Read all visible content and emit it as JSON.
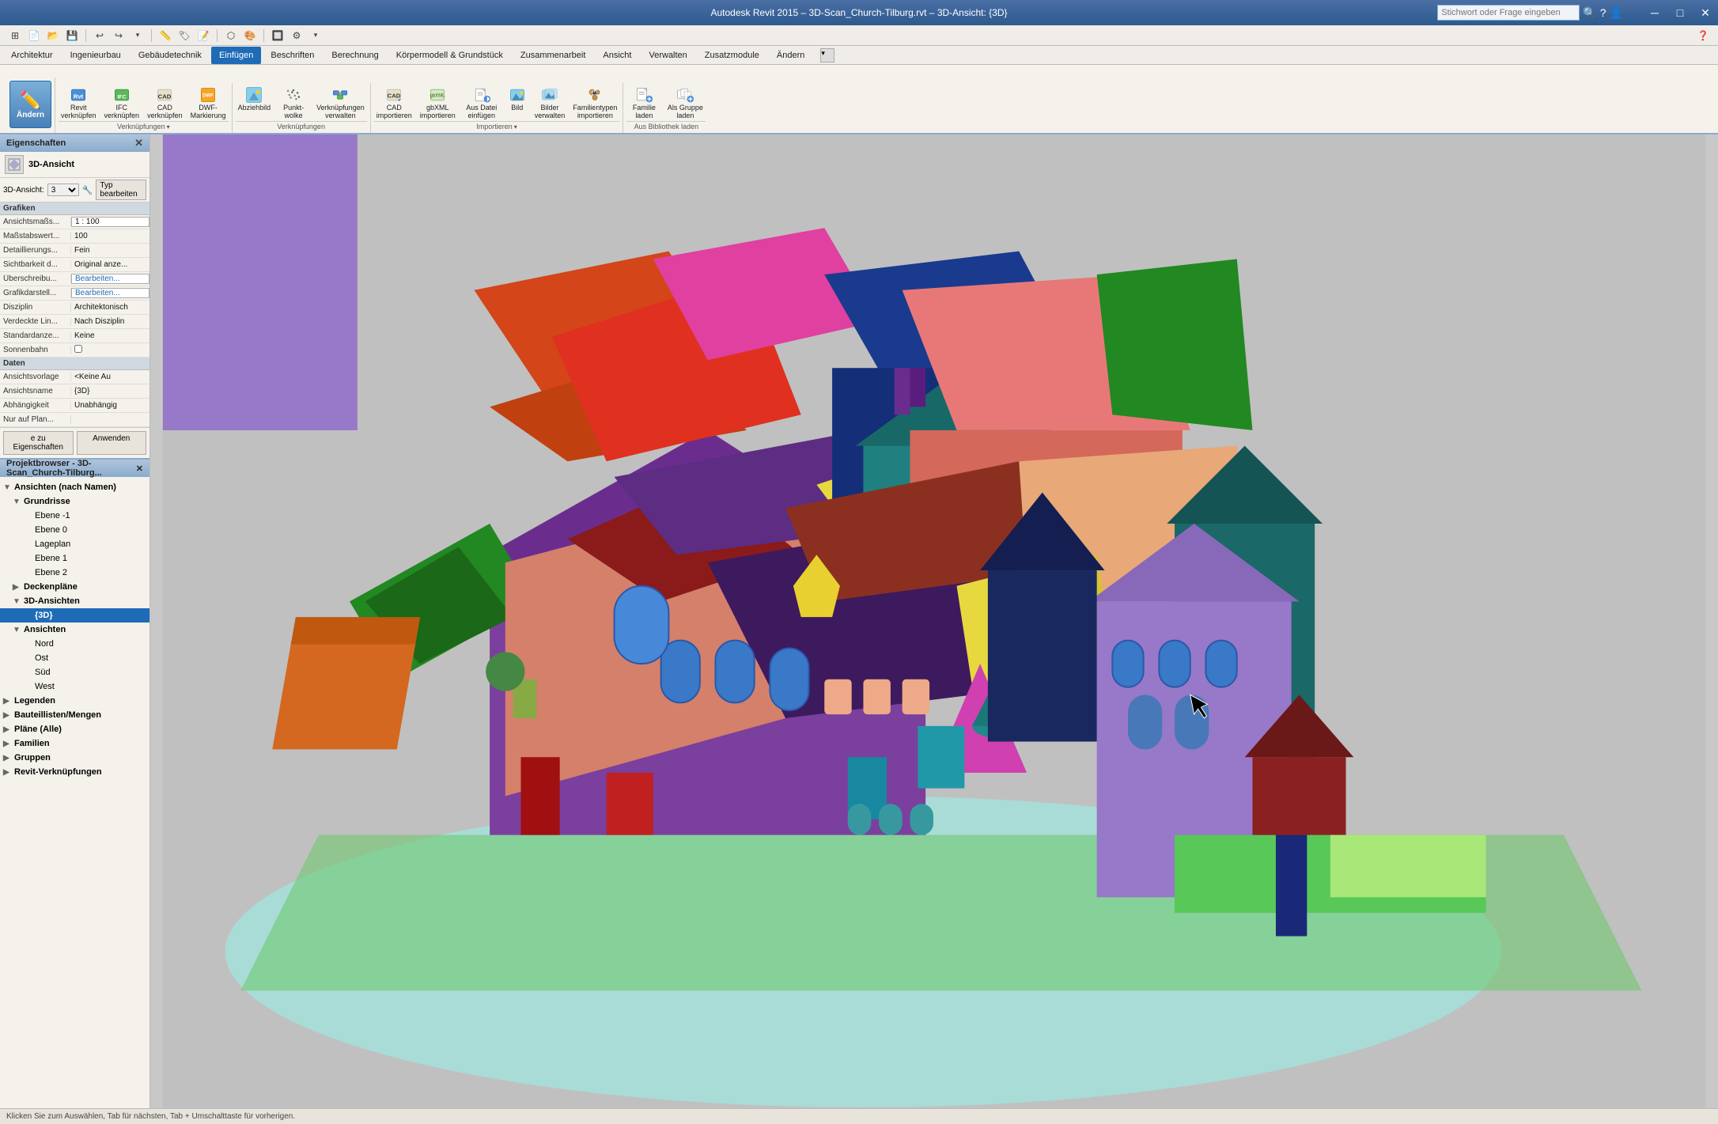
{
  "titlebar": {
    "title": "Autodesk Revit 2015 – 3D-Scan_Church-Tilburg.rvt – 3D-Ansicht: {3D}",
    "search_placeholder": "Stichwort oder Frage eingeben"
  },
  "quickaccess": {
    "buttons": [
      "⊞",
      "↩",
      "↪",
      "⭮",
      "▾",
      "▾",
      "▾",
      "▾",
      "▾",
      "▾",
      "▾",
      "▾",
      "▾",
      "▾",
      "▾",
      "▾",
      "▾",
      "▾"
    ]
  },
  "menubar": {
    "items": [
      {
        "label": "Architektur",
        "active": false
      },
      {
        "label": "Ingenieurbau",
        "active": false
      },
      {
        "label": "Gebäudetechnik",
        "active": false
      },
      {
        "label": "Einfügen",
        "active": true
      },
      {
        "label": "Beschriften",
        "active": false
      },
      {
        "label": "Berechnung",
        "active": false
      },
      {
        "label": "Körpermodell & Grundstück",
        "active": false
      },
      {
        "label": "Zusammenarbeit",
        "active": false
      },
      {
        "label": "Ansicht",
        "active": false
      },
      {
        "label": "Verwalten",
        "active": false
      },
      {
        "label": "Zusatzmodule",
        "active": false
      },
      {
        "label": "Ändern",
        "active": false
      }
    ]
  },
  "ribbon": {
    "ändern_label": "Ändern",
    "groups": [
      {
        "label": "Verknüpfungen",
        "items": [
          {
            "icon": "🏠",
            "label": "Revit\nverknüpfen",
            "type": "small"
          },
          {
            "icon": "📋",
            "label": "IFC\nverknüpfen",
            "type": "small"
          },
          {
            "icon": "📐",
            "label": "CAD\nverknüpfen",
            "type": "small"
          },
          {
            "icon": "📄",
            "label": "DWF-\nMarkierung",
            "type": "small"
          }
        ]
      },
      {
        "label": "Verknüpfungen",
        "items": [
          {
            "icon": "🖼",
            "label": "Abziehbild",
            "type": "small"
          },
          {
            "icon": "·:·",
            "label": "Punkt-\nwolke",
            "type": "small"
          },
          {
            "icon": "🔗",
            "label": "Verknüpfungen\nverwalten",
            "type": "small"
          }
        ]
      },
      {
        "label": "Importieren",
        "items": [
          {
            "icon": "📐",
            "label": "CAD\nimportieren",
            "type": "small"
          },
          {
            "icon": "📊",
            "label": "gbXML\nimportieren",
            "type": "small"
          },
          {
            "icon": "📁",
            "label": "Aus Datei\neinfügen",
            "type": "small"
          },
          {
            "icon": "🖼",
            "label": "Bild",
            "type": "small"
          },
          {
            "icon": "🖼",
            "label": "Bilder\nverwalten",
            "type": "small"
          },
          {
            "icon": "👪",
            "label": "Familientypen\nimportieren",
            "type": "small"
          }
        ]
      },
      {
        "label": "Aus Bibliothek laden",
        "items": [
          {
            "icon": "📚",
            "label": "Familie\nladen",
            "type": "small"
          },
          {
            "icon": "👥",
            "label": "Als Gruppe\nladen",
            "type": "small"
          }
        ]
      }
    ]
  },
  "properties": {
    "header": "Eigenschaften",
    "view_label": "3D-Ansicht",
    "ansicht_label": "3D-Ansicht:",
    "ansicht_value": "3",
    "type_edit_label": "Typ bearbeiten",
    "sections": [
      {
        "name": "Grafiken",
        "rows": [
          {
            "key": "Ansichtsmaßs...",
            "val": "1 : 100",
            "editable": true
          },
          {
            "key": "Maßstabswert...",
            "val": "100"
          },
          {
            "key": "Detaillierungs...",
            "val": "Fein"
          },
          {
            "key": "Sichtbarkeit d...",
            "val": "Original anze..."
          },
          {
            "key": "Überschreibu...",
            "val": "Bearbeiten...",
            "editable": true
          },
          {
            "key": "Grafikdarstell...",
            "val": "Bearbeiten...",
            "editable": true
          },
          {
            "key": "Disziplin",
            "val": "Architektonisch"
          },
          {
            "key": "Verdeckte Lin...",
            "val": "Nach Disziplin"
          },
          {
            "key": "Standardanze...",
            "val": "Keine"
          },
          {
            "key": "Sonnenbahn",
            "val": "☐"
          }
        ]
      },
      {
        "name": "Daten",
        "rows": [
          {
            "key": "Ansichtsvorlage",
            "val": "<Keine Au"
          },
          {
            "key": "Ansichtsname",
            "val": "{3D}"
          },
          {
            "key": "Abhängigkeit",
            "val": "Unabhängig"
          },
          {
            "key": "Nur auf Plan...",
            "val": ""
          }
        ]
      }
    ],
    "apply_btn": "e zu Eigenschaften",
    "apply_btn2": "Anwenden"
  },
  "project_browser": {
    "header": "Projektbrowser - 3D-Scan_Church-Tilburg...",
    "close": "×",
    "tree": [
      {
        "level": 0,
        "label": "Ansichten (nach Namen)",
        "expand": "▼",
        "bold": true
      },
      {
        "level": 1,
        "label": "Grundrisse",
        "expand": "▼",
        "bold": true
      },
      {
        "level": 2,
        "label": "Ebene -1",
        "expand": "",
        "bold": false
      },
      {
        "level": 2,
        "label": "Ebene 0",
        "expand": "",
        "bold": false
      },
      {
        "level": 2,
        "label": "Lageplan",
        "expand": "",
        "bold": false
      },
      {
        "level": 2,
        "label": "Ebene 1",
        "expand": "",
        "bold": false
      },
      {
        "level": 2,
        "label": "Ebene 2",
        "expand": "",
        "bold": false
      },
      {
        "level": 1,
        "label": "Deckenpläne",
        "expand": "▶",
        "bold": true
      },
      {
        "level": 1,
        "label": "3D-Ansichten",
        "expand": "▼",
        "bold": true
      },
      {
        "level": 2,
        "label": "{3D}",
        "expand": "",
        "bold": true,
        "selected": true
      },
      {
        "level": 1,
        "label": "Ansichten",
        "expand": "▼",
        "bold": true
      },
      {
        "level": 2,
        "label": "Nord",
        "expand": "",
        "bold": false
      },
      {
        "level": 2,
        "label": "Ost",
        "expand": "",
        "bold": false
      },
      {
        "level": 2,
        "label": "Süd",
        "expand": "",
        "bold": false
      },
      {
        "level": 2,
        "label": "West",
        "expand": "",
        "bold": false
      },
      {
        "level": 0,
        "label": "Legenden",
        "expand": "▶",
        "bold": true
      },
      {
        "level": 0,
        "label": "Bauteillisten/Mengen",
        "expand": "▶",
        "bold": true
      },
      {
        "level": 0,
        "label": "Pläne (Alle)",
        "expand": "▶",
        "bold": true
      },
      {
        "level": 0,
        "label": "Familien",
        "expand": "▶",
        "bold": true
      },
      {
        "level": 0,
        "label": "Gruppen",
        "expand": "▶",
        "bold": true
      },
      {
        "level": 0,
        "label": "Revit-Verknüpfungen",
        "expand": "▶",
        "bold": true
      }
    ]
  },
  "viewport": {
    "title": "3D-Ansicht: {3D}"
  }
}
